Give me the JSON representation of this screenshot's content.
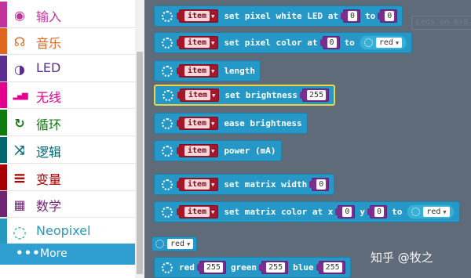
{
  "toolbox": {
    "categories": [
      {
        "label": "输入",
        "icon": "target-icon",
        "glyph": "◉",
        "color": "#c3339c"
      },
      {
        "label": "音乐",
        "icon": "headphones-icon",
        "glyph": "☊",
        "color": "#e06620"
      },
      {
        "label": "LED",
        "icon": "toggle-icon",
        "glyph": "◑",
        "color": "#5c2d91"
      },
      {
        "label": "无线",
        "icon": "signal-icon",
        "glyph": "▂▄▆",
        "color": "#e3008c"
      },
      {
        "label": "循环",
        "icon": "refresh-icon",
        "glyph": "↻",
        "color": "#107c10"
      },
      {
        "label": "逻辑",
        "icon": "shuffle-icon",
        "glyph": "⤨",
        "color": "#006970"
      },
      {
        "label": "变量",
        "icon": "list-icon",
        "glyph": "≡",
        "color": "#a80000"
      },
      {
        "label": "数学",
        "icon": "calculator-icon",
        "glyph": "▦",
        "color": "#712672"
      },
      {
        "label": "Neopixel",
        "icon": "neopixel-icon",
        "glyph": "◌",
        "color": "#2699bf"
      }
    ],
    "more_label": "More",
    "more_icon": "more-dots-icon"
  },
  "workspace": {
    "ghost_text": "Leds on 8x8",
    "blocks": [
      {
        "var": "item",
        "parts": [
          {
            "t": "text",
            "v": "set pixel white LED at"
          },
          {
            "t": "num",
            "v": "0"
          },
          {
            "t": "text",
            "v": "to"
          },
          {
            "t": "num",
            "v": "0"
          }
        ]
      },
      {
        "var": "item",
        "parts": [
          {
            "t": "text",
            "v": "set pixel color at"
          },
          {
            "t": "num",
            "v": "0"
          },
          {
            "t": "text",
            "v": "to"
          },
          {
            "t": "drop",
            "v": "red"
          }
        ]
      },
      {
        "var": "item",
        "parts": [
          {
            "t": "text",
            "v": "length"
          }
        ]
      },
      {
        "var": "item",
        "selected": true,
        "parts": [
          {
            "t": "text",
            "v": "set brightness"
          },
          {
            "t": "num",
            "v": "255"
          }
        ]
      },
      {
        "var": "item",
        "parts": [
          {
            "t": "text",
            "v": "ease brightness"
          }
        ]
      },
      {
        "var": "item",
        "parts": [
          {
            "t": "text",
            "v": "power (mA)"
          }
        ]
      },
      {
        "var": "item",
        "parts": [
          {
            "t": "text",
            "v": "set matrix width"
          },
          {
            "t": "num",
            "v": "0"
          }
        ]
      },
      {
        "var": "item",
        "parts": [
          {
            "t": "text",
            "v": "set matrix color at x"
          },
          {
            "t": "num",
            "v": "0"
          },
          {
            "t": "text",
            "v": "y"
          },
          {
            "t": "num",
            "v": "0"
          },
          {
            "t": "text",
            "v": "to"
          },
          {
            "t": "drop",
            "v": "red"
          }
        ]
      },
      {
        "var": null,
        "parts": [
          {
            "t": "dval",
            "v": "red"
          }
        ]
      },
      {
        "var": null,
        "parts": [
          {
            "t": "text",
            "v": "red"
          },
          {
            "t": "num",
            "v": "255"
          },
          {
            "t": "text",
            "v": "green"
          },
          {
            "t": "num",
            "v": "255"
          },
          {
            "t": "text",
            "v": "blue"
          },
          {
            "t": "num",
            "v": "255"
          }
        ]
      }
    ]
  },
  "watermark": "知乎 @牧之"
}
